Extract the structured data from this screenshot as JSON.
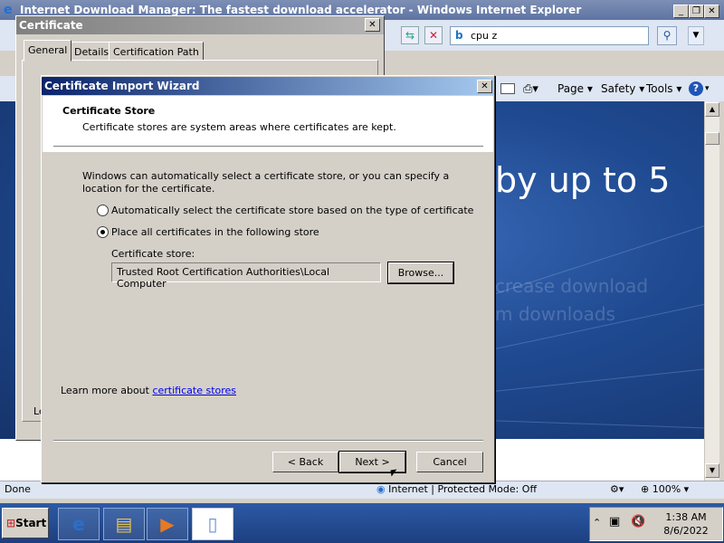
{
  "ie": {
    "window_title": "Internet Download Manager: The fastest download accelerator - Windows Internet Explorer",
    "search_value": "cpu z",
    "command_bar": {
      "page": "Page",
      "safety": "Safety",
      "tools": "Tools"
    },
    "hero_text": "by up to 5",
    "faded_line_1": "crease download",
    "faded_line_2": "m downloads",
    "status_left": "Done",
    "status_zone": "Internet | Protected Mode: Off",
    "zoom": "100%"
  },
  "cert": {
    "title": "Certificate",
    "tabs": [
      "General",
      "Details",
      "Certification Path"
    ],
    "partial_label": "Le"
  },
  "wizard": {
    "title": "Certificate Import Wizard",
    "heading": "Certificate Store",
    "subheading": "Certificate stores are system areas where certificates are kept.",
    "intro": "Windows can automatically select a certificate store, or you can specify a location for the certificate.",
    "radio_auto": "Automatically select the certificate store based on the type of certificate",
    "radio_place": "Place all certificates in the following store",
    "store_label": "Certificate store:",
    "store_value": "Trusted Root Certification Authorities\\Local Computer",
    "browse": "Browse...",
    "learn_prefix": "Learn more about ",
    "learn_link": "certificate stores",
    "back": "< Back",
    "next": "Next >",
    "cancel": "Cancel"
  },
  "taskbar": {
    "start": "Start",
    "time": "1:38 AM",
    "date": "8/6/2022"
  }
}
